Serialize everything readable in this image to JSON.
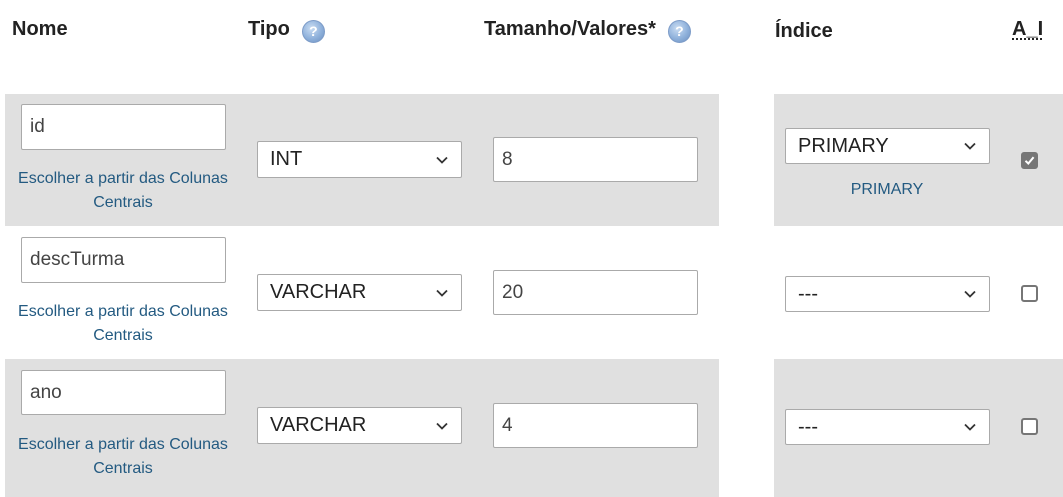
{
  "headers": {
    "nome": "Nome",
    "tipo": "Tipo",
    "tamanho": "Tamanho/Valores*",
    "indice": "Índice",
    "ai": "A_I"
  },
  "help_icon": "question-mark-icon",
  "colors": {
    "row_bg": "#e0e0e0",
    "link": "#235a81"
  },
  "rows": [
    {
      "name": "id",
      "central_columns_link": "Escolher a partir das Colunas Centrais",
      "type": "INT",
      "length": "8",
      "index": "PRIMARY",
      "index_note": "PRIMARY",
      "auto_increment": true
    },
    {
      "name": "descTurma",
      "central_columns_link": "Escolher a partir das Colunas Centrais",
      "type": "VARCHAR",
      "length": "20",
      "index": "---",
      "auto_increment": false
    },
    {
      "name": "ano",
      "central_columns_link": "Escolher a partir das Colunas Centrais",
      "type": "VARCHAR",
      "length": "4",
      "index": "---",
      "auto_increment": false
    }
  ]
}
